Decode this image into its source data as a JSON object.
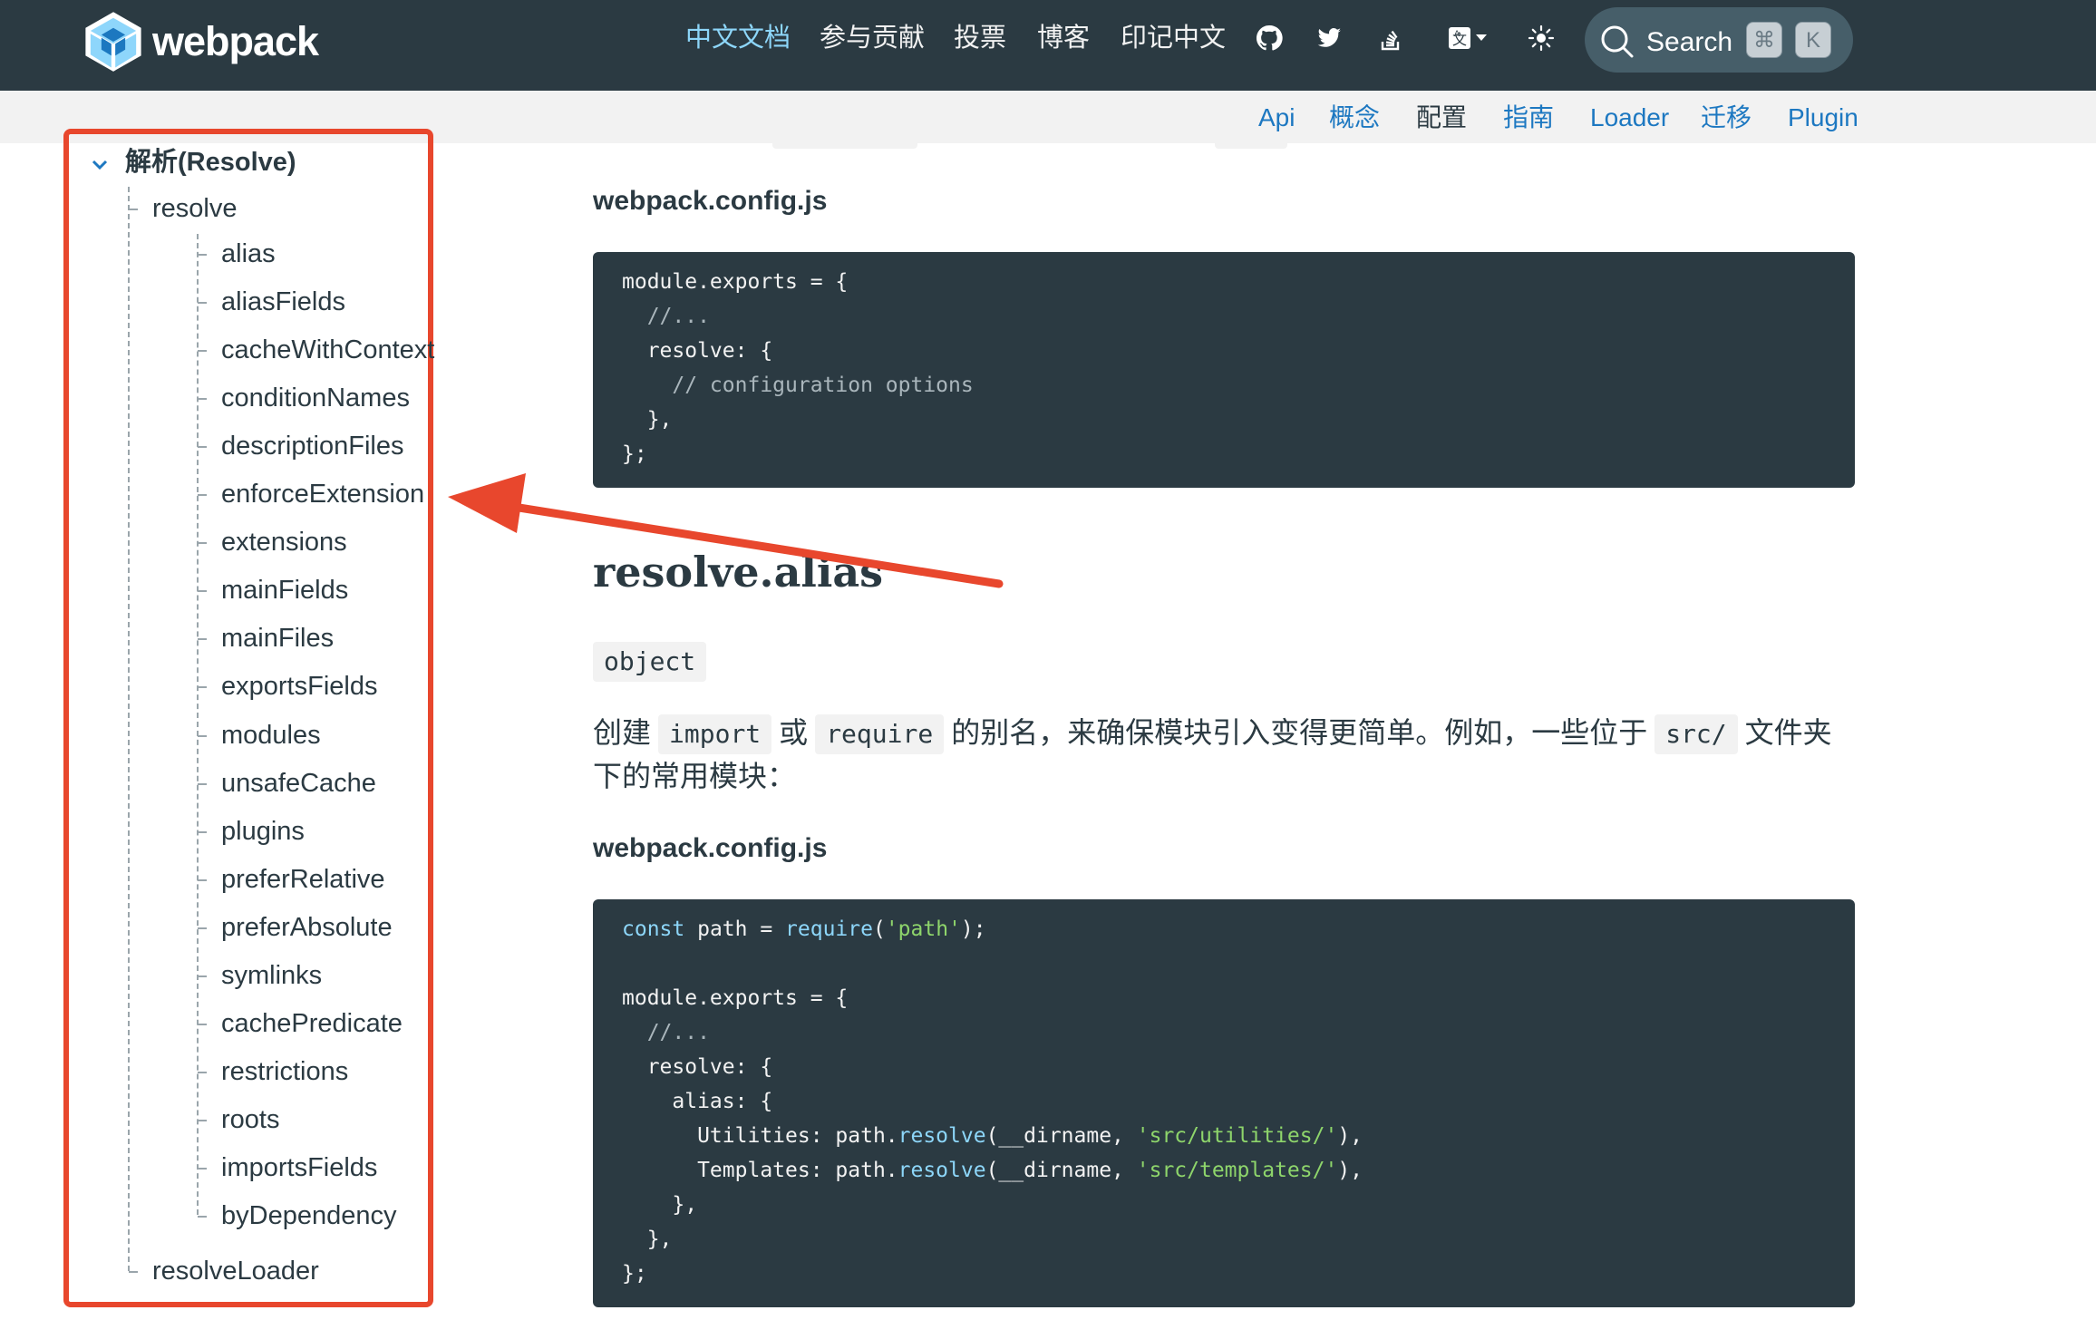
{
  "header": {
    "logo_text": "webpack",
    "nav": [
      {
        "label": "中文文档",
        "active": true
      },
      {
        "label": "参与贡献",
        "active": false
      },
      {
        "label": "投票",
        "active": false
      },
      {
        "label": "博客",
        "active": false
      },
      {
        "label": "印记中文",
        "active": false
      }
    ],
    "icons": [
      "github-icon",
      "twitter-icon",
      "stackoverflow-icon",
      "language-icon",
      "theme-icon"
    ],
    "search": {
      "label": "Search",
      "kbd_modifier": "⌘",
      "kbd_key": "K"
    },
    "colors": {
      "bg": "#2b3a42",
      "accent": "#8dd6f9"
    }
  },
  "subnav": {
    "items": [
      {
        "label": "Api",
        "active": false
      },
      {
        "label": "概念",
        "active": false
      },
      {
        "label": "配置",
        "active": true
      },
      {
        "label": "指南",
        "active": false
      },
      {
        "label": "Loader",
        "active": false
      },
      {
        "label": "迁移",
        "active": false
      },
      {
        "label": "Plugin",
        "active": false
      }
    ]
  },
  "sidebar": {
    "section_title": "解析(Resolve)",
    "level1": [
      "resolve",
      "resolveLoader"
    ],
    "resolve_children": [
      "alias",
      "aliasFields",
      "cacheWithContext",
      "conditionNames",
      "descriptionFiles",
      "enforceExtension",
      "extensions",
      "mainFields",
      "mainFiles",
      "exportsFields",
      "modules",
      "unsafeCache",
      "plugins",
      "preferRelative",
      "preferAbsolute",
      "symlinks",
      "cachePredicate",
      "restrictions",
      "roots",
      "importsFields",
      "byDependency"
    ],
    "highlight_color": "#e8472d"
  },
  "content": {
    "file_label_1": "webpack.config.js",
    "code1": [
      "module.exports = {",
      "  //...",
      "  resolve: {",
      "    // configuration options",
      "  },",
      "};"
    ],
    "heading": "resolve.alias",
    "type_badge": "object",
    "para": {
      "t1": "创建",
      "c1": "import",
      "t2": "或",
      "c2": "require",
      "t3": "的别名，来确保模块引入变得更简单。例如，一些位于",
      "c3": "src/",
      "t4": "文件夹下的常用模块："
    },
    "file_label_2": "webpack.config.js",
    "code2": {
      "l1_kw": "const",
      "l1_a": " path = ",
      "l1_fn": "require",
      "l1_b": "(",
      "l1_str": "'path'",
      "l1_c": ");",
      "l2": "module.exports = {",
      "l3": "  //...",
      "l4": "  resolve: {",
      "l5": "    alias: {",
      "l6_a": "      Utilities: path.",
      "l6_fn": "resolve",
      "l6_b": "(__dirname, ",
      "l6_str": "'src/utilities/'",
      "l6_c": "),",
      "l7_a": "      Templates: path.",
      "l7_fn": "resolve",
      "l7_b": "(__dirname, ",
      "l7_str": "'src/templates/'",
      "l7_c": "),",
      "l8": "    },",
      "l9": "  },",
      "l10": "};"
    }
  }
}
